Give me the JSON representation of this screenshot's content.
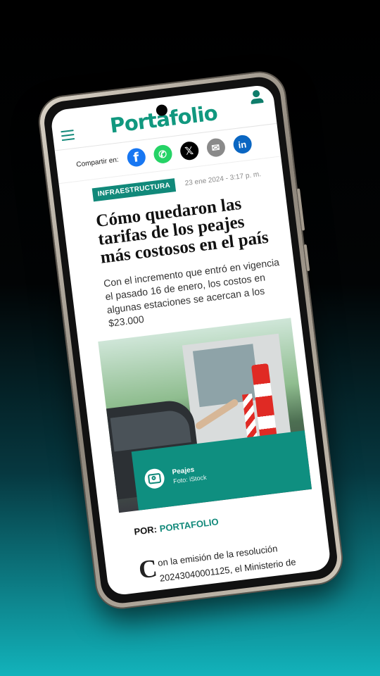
{
  "header": {
    "logo": "Portafolio"
  },
  "share": {
    "label": "Compartir en:",
    "icons": [
      "facebook-icon",
      "whatsapp-icon",
      "x-icon",
      "email-icon",
      "linkedin-icon"
    ],
    "glyphs": {
      "facebook": "f",
      "whatsapp": "✆",
      "x": "𝕏",
      "email": "✉",
      "linkedin": "in"
    }
  },
  "article": {
    "section": "INFRAESTRUCTURA",
    "date": "23 ene 2024 - 3:17 p. m.",
    "headline": "Cómo quedaron las tarifas de los peajes más costosos en el país",
    "lead": "Con el incremento que entró en vigencia el pasado 16 de enero, los costos en algunas estaciones se acercan a los $23.000",
    "photo": {
      "caption_title": "Peajes",
      "caption_credit": "Foto: iStock"
    },
    "byline_prefix": "POR:",
    "byline_name": "PORTAFOLIO",
    "body_dropcap": "C",
    "body": "on la emisión de la resolución 20243040001125, el Ministerio de Transporte fijó el porcentaje de"
  },
  "colors": {
    "brand": "#11897a",
    "background_top": "#000000",
    "background_bottom": "#12b3bb"
  }
}
